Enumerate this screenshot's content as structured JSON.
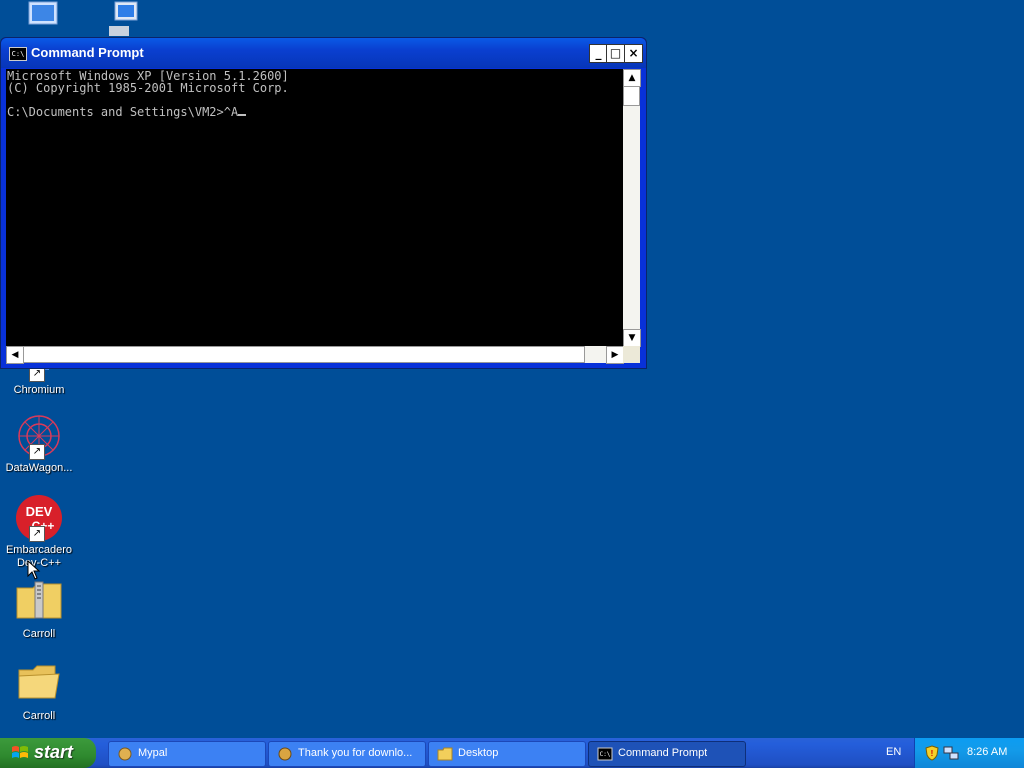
{
  "desktop": {
    "icons": [
      {
        "label": "Chromium"
      },
      {
        "label": "DataWagon..."
      },
      {
        "label": "Embarcadero\nDev-C++"
      },
      {
        "label": "Carroll"
      },
      {
        "label": "Carroll"
      }
    ]
  },
  "window": {
    "title": "Command Prompt",
    "console_lines": [
      "Microsoft Windows XP [Version 5.1.2600]",
      "(C) Copyright 1985-2001 Microsoft Corp.",
      "",
      "C:\\Documents and Settings\\VM2>^A"
    ],
    "buttons": {
      "minimize": "_",
      "maximize": "□",
      "close": "×"
    }
  },
  "taskbar": {
    "start_label": "start",
    "items": [
      {
        "label": "Mypal"
      },
      {
        "label": "Thank you for downlo..."
      },
      {
        "label": "Desktop"
      },
      {
        "label": "Command Prompt"
      }
    ],
    "language": "EN",
    "clock": "8:26 AM"
  },
  "colors": {
    "desktop_bg": "#004e98",
    "titlebar": "#0a5ae6",
    "taskbar": "#245edb",
    "start_green": "#3c9a3c",
    "console_bg": "#000000",
    "console_text": "#c0c0c0"
  }
}
